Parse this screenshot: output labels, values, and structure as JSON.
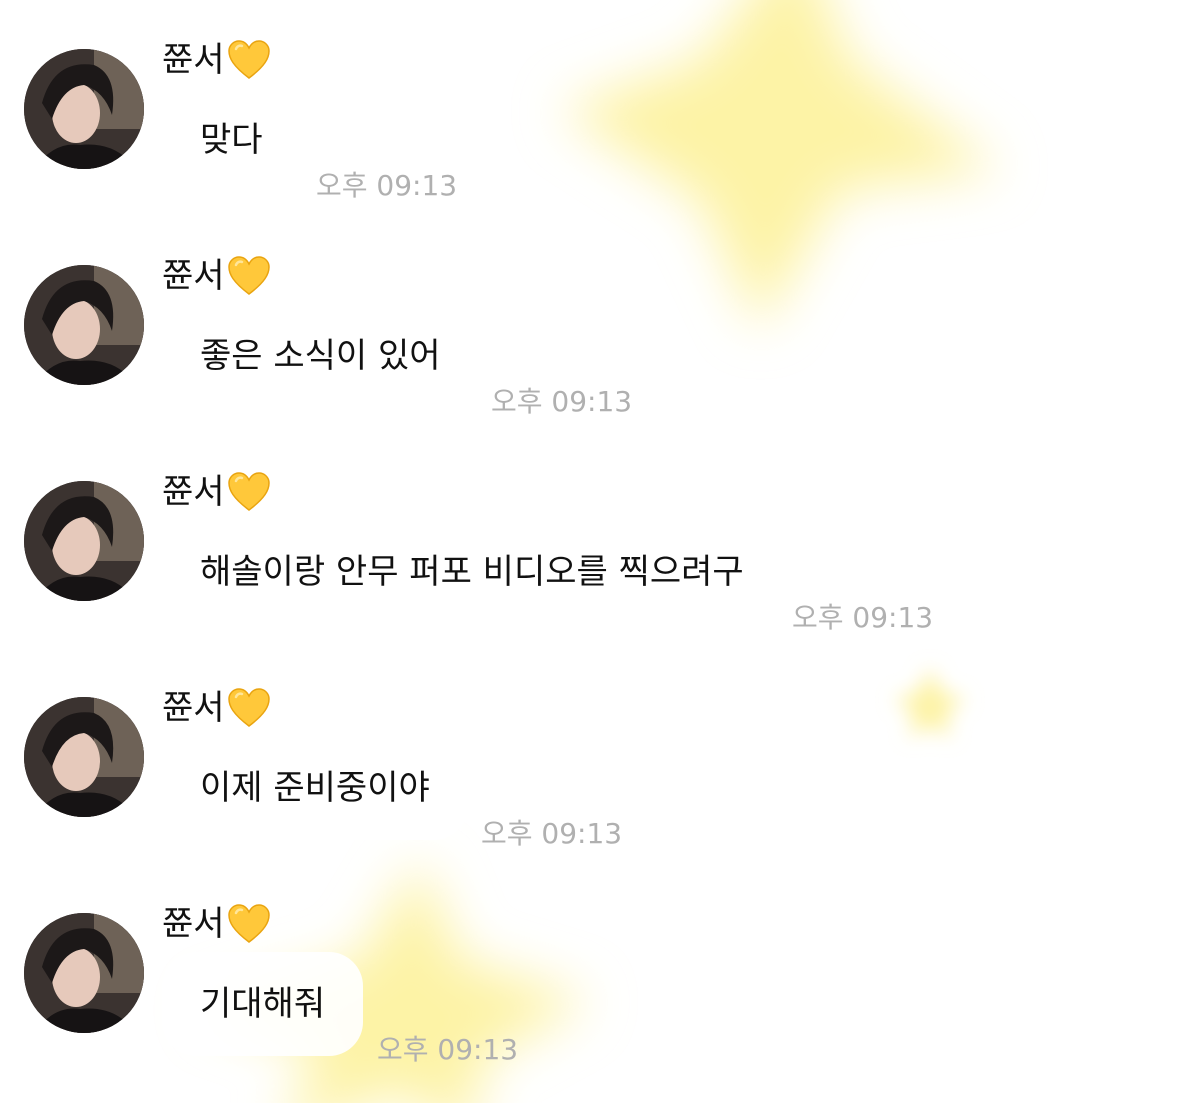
{
  "theme": {
    "star_color": "#fdf3a6",
    "time_color": "#b0b0b0",
    "heart_color": "#ffc83a"
  },
  "messages": [
    {
      "sender": "쮼서",
      "sender_emoji": "yellow-heart-icon",
      "text": "맞다",
      "time": "오후 09:13"
    },
    {
      "sender": "쮼서",
      "sender_emoji": "yellow-heart-icon",
      "text": "좋은 소식이 있어",
      "time": "오후 09:13"
    },
    {
      "sender": "쮼서",
      "sender_emoji": "yellow-heart-icon",
      "text": "해솔이랑 안무 퍼포 비디오를 찍으려구",
      "time": "오후 09:13"
    },
    {
      "sender": "쮼서",
      "sender_emoji": "yellow-heart-icon",
      "text": "이제 준비중이야",
      "time": "오후 09:13"
    },
    {
      "sender": "쮼서",
      "sender_emoji": "yellow-heart-icon",
      "text": "기대해줘",
      "time": "오후 09:13"
    }
  ]
}
